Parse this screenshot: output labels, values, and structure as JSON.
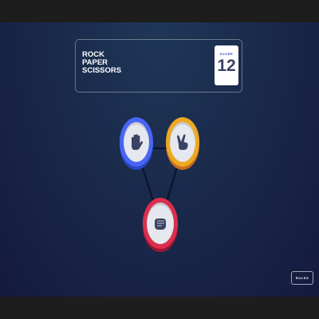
{
  "header": {
    "title_lines": [
      "ROCK",
      "PAPER",
      "SCISSORS"
    ],
    "score_label": "SCORE",
    "score_value": "12"
  },
  "choices": [
    {
      "name": "paper",
      "icon": "hand-paper-icon",
      "color": "#4865f4"
    },
    {
      "name": "scissors",
      "icon": "hand-scissors-icon",
      "color": "#eca922"
    },
    {
      "name": "rock",
      "icon": "hand-rock-icon",
      "color": "#dc2e4e"
    }
  ],
  "rules_button": {
    "label": "RULES"
  },
  "colors": {
    "background_top": "#1f3757",
    "background_bottom": "#141a3d",
    "score_text": "#3b4363",
    "score_label": "#2a46c0"
  }
}
